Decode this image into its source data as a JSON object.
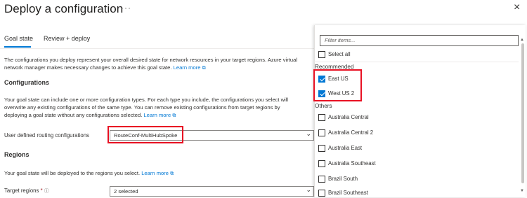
{
  "header": {
    "title": "Deploy a configuration",
    "more": "···",
    "close": "×"
  },
  "tabs": [
    {
      "label": "Goal state",
      "active": true
    },
    {
      "label": "Review + deploy",
      "active": false
    }
  ],
  "intro": {
    "line1": "The configurations you deploy represent your overall desired state for network resources in your target regions. Azure virtual",
    "line2": "network manager makes necessary changes to achieve this goal state.",
    "link": "Learn more"
  },
  "configurations": {
    "heading": "Configurations",
    "line1": "Your goal state can include one or more configuration types. For each type you include, the configurations you select will",
    "line2": "overwrite any existing configurations of the same type. You can remove existing configurations from target regions by",
    "line3": "deploying a goal state without any configurations selected.",
    "link": "Learn more",
    "field_label": "User defined routing configurations",
    "field_value": "RouteConf-MultiHubSpoke"
  },
  "regions": {
    "heading": "Regions",
    "line1": "Your goal state will be deployed to the regions you select.",
    "link": "Learn more",
    "field_label": "Target regions",
    "required_mark": "*",
    "field_value": "2 selected"
  },
  "panel": {
    "filter_placeholder": "Filter items...",
    "select_all": "Select all",
    "recommended_label": "Recommended",
    "recommended": [
      {
        "label": "East US",
        "checked": true
      },
      {
        "label": "West US 2",
        "checked": true
      }
    ],
    "others_label": "Others",
    "others": [
      {
        "label": "Australia Central",
        "checked": false
      },
      {
        "label": "Australia Central 2",
        "checked": false
      },
      {
        "label": "Australia East",
        "checked": false
      },
      {
        "label": "Australia Southeast",
        "checked": false
      },
      {
        "label": "Brazil South",
        "checked": false
      },
      {
        "label": "Brazil Southeast",
        "checked": false
      }
    ]
  },
  "colors": {
    "accent": "#0078d4",
    "highlight": "#e81123"
  }
}
